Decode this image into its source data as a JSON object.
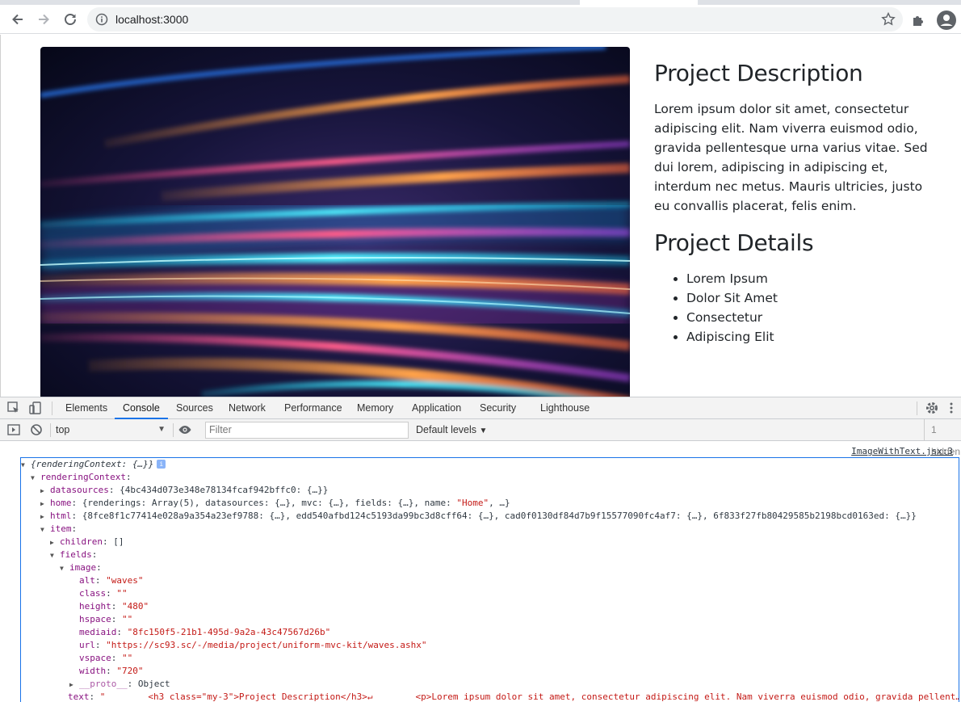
{
  "browser": {
    "url": "localhost:3000"
  },
  "page": {
    "image_alt": "waves",
    "heading_description": "Project Description",
    "description": "Lorem ipsum dolor sit amet, consectetur adipiscing elit. Nam viverra euismod odio, gravida pellentesque urna varius vitae. Sed dui lorem, adipiscing in adipiscing et, interdum nec metus. Mauris ultricies, justo eu convallis placerat, felis enim.",
    "heading_details": "Project Details",
    "details": [
      "Lorem Ipsum",
      "Dolor Sit Amet",
      "Consectetur",
      "Adipiscing Elit"
    ]
  },
  "devtools": {
    "tabs": [
      "Elements",
      "Console",
      "Sources",
      "Network",
      "Performance",
      "Memory",
      "Application",
      "Security",
      "Lighthouse"
    ],
    "active_tab": "Console",
    "context": "top",
    "filter_placeholder": "Filter",
    "levels": "Default levels",
    "hidden": "1 hidden",
    "source_link": "ImageWithText.jsx:3"
  },
  "console": {
    "root": "{renderingContext: {…}}",
    "rendering_context_key": "renderingContext",
    "datasources_key": "datasources",
    "datasources_val": "{4bc434d073e348e78134fcaf942bffc0: {…}}",
    "home_key": "home",
    "home_val_a": "{renderings: Array(5), datasources: {…}, mvc: {…}, fields: {…}, name: ",
    "home_name": "\"Home\"",
    "home_val_b": ", …}",
    "html_key": "html",
    "html_val": "{8fce8f1c77414e028a9a354a23ef9788: {…}, edd540afbd124c5193da99bc3d8cff64: {…}, cad0f0130df84d7b9f15577090fc4af7: {…}, 6f833f27fb80429585b2198bcd0163ed: {…}}",
    "item_key": "item",
    "children_key": "children",
    "children_val": "[]",
    "fields_key": "fields",
    "image_key": "image",
    "props": [
      {
        "k": "alt",
        "v": "\"waves\""
      },
      {
        "k": "class",
        "v": "\"\""
      },
      {
        "k": "height",
        "v": "\"480\""
      },
      {
        "k": "hspace",
        "v": "\"\""
      },
      {
        "k": "mediaid",
        "v": "\"8fc150f5-21b1-495d-9a2a-43c47567d26b\""
      },
      {
        "k": "url",
        "v": "\"https://sc93.sc/-/media/project/uniform-mvc-kit/waves.ashx\""
      },
      {
        "k": "vspace",
        "v": "\"\""
      },
      {
        "k": "width",
        "v": "\"720\""
      }
    ],
    "proto_key": "__proto__",
    "proto_val": "Object",
    "text_key": "text",
    "text_val_a": "\"        <h3 class=\"my-3\">Project Description</h3>↵        <p>Lorem ipsum dolor sit amet, consectetur adipiscing elit. Nam viverra euismod odio, gravida pellent…"
  },
  "colors": {
    "accent": "#1a73e8",
    "console_key": "#881280",
    "console_string": "#c41a16"
  }
}
